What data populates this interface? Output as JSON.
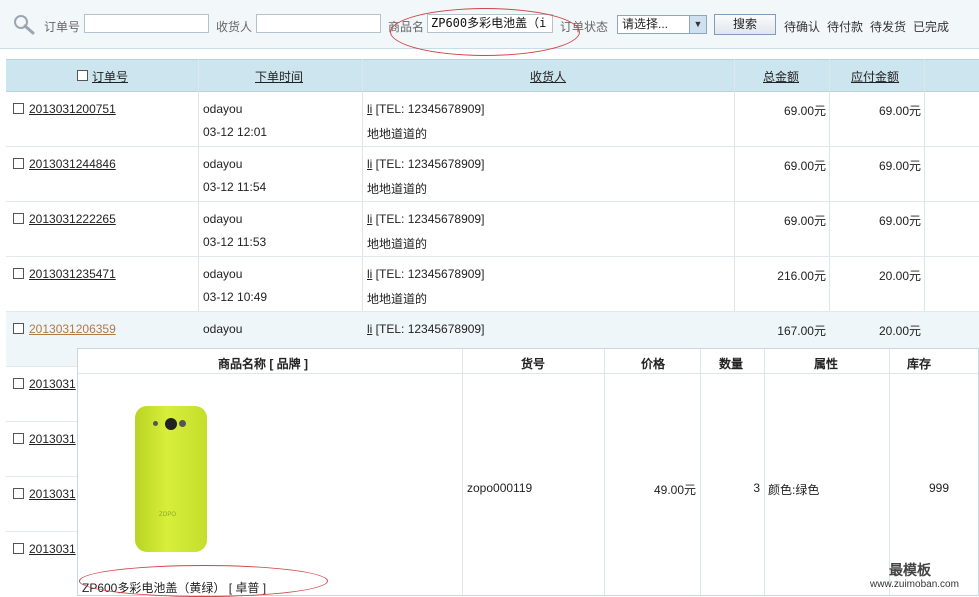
{
  "search": {
    "order_no_label": "订单号",
    "order_no_value": "",
    "consignee_label": "收货人",
    "consignee_value": "",
    "product_label": "商品名",
    "product_value": "ZP600多彩电池盖（i",
    "status_label": "订单状态",
    "status_selected": "请选择...",
    "search_button": "搜索",
    "quick_filters": [
      "待确认",
      "待付款",
      "待发货",
      "已完成"
    ]
  },
  "table": {
    "headers": [
      "订单号",
      "下单时间",
      "收货人",
      "总金额",
      "应付金额"
    ],
    "rows": [
      {
        "order_no": "2013031200751",
        "user": "odayou",
        "time": "03-12 12:01",
        "name": "li",
        "tel": " [TEL: 12345678909]",
        "address": "地地道道的",
        "total": "69.00元",
        "payable": "69.00元"
      },
      {
        "order_no": "2013031244846",
        "user": "odayou",
        "time": "03-12 11:54",
        "name": "li",
        "tel": " [TEL: 12345678909]",
        "address": "地地道道的",
        "total": "69.00元",
        "payable": "69.00元"
      },
      {
        "order_no": "2013031222265",
        "user": "odayou",
        "time": "03-12 11:53",
        "name": "li",
        "tel": " [TEL: 12345678909]",
        "address": "地地道道的",
        "total": "69.00元",
        "payable": "69.00元"
      },
      {
        "order_no": "2013031235471",
        "user": "odayou",
        "time": "03-12 10:49",
        "name": "li",
        "tel": " [TEL: 12345678909]",
        "address": "地地道道的",
        "total": "216.00元",
        "payable": "20.00元"
      },
      {
        "order_no": "2013031206359",
        "user": "odayou",
        "time": "",
        "name": "li",
        "tel": " [TEL: 12345678909]",
        "address": "",
        "total": "167.00元",
        "payable": "20.00元"
      }
    ],
    "truncated_order_nos": [
      "2013031",
      "2013031",
      "2013031",
      "2013031"
    ]
  },
  "popup": {
    "headers": [
      "商品名称 [ 品牌 ]",
      "货号",
      "价格",
      "数量",
      "属性",
      "库存"
    ],
    "item": {
      "product_name": "ZP600多彩电池盖（黄绿） [ 卓普 ]",
      "sku": "zopo000119",
      "price": "49.00元",
      "quantity": "3",
      "attribute": "颜色:绿色",
      "stock": "999"
    }
  },
  "watermark": {
    "title": "最模板",
    "url": "www.zuimoban.com"
  },
  "colors": {
    "header_bg": "#cde5ee",
    "search_bg": "#f2f7fa",
    "highlight_link": "#b07a45",
    "annotation": "#d0454a",
    "product_color": "#c8e22f"
  }
}
